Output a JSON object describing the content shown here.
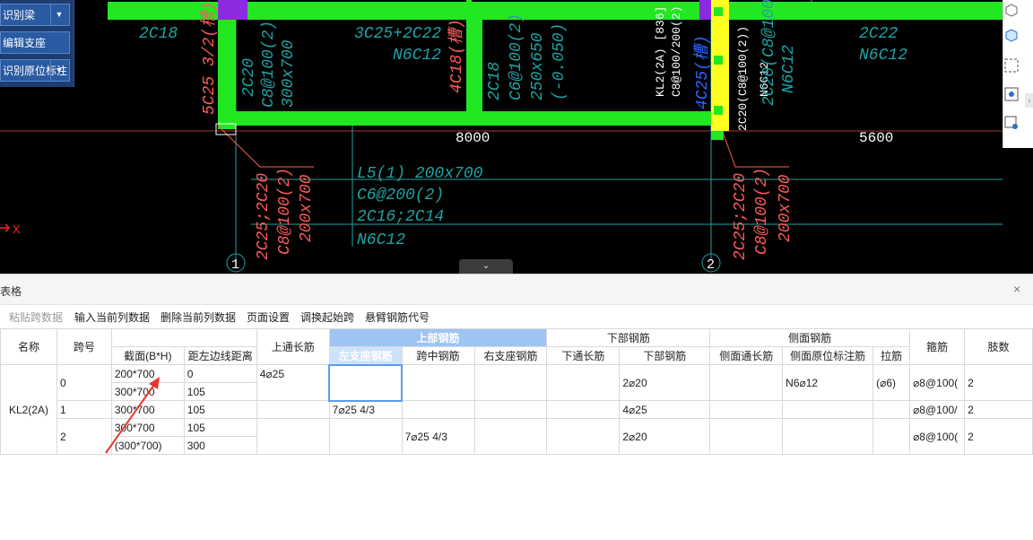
{
  "left_panel": {
    "items": [
      "识别梁",
      "编辑支座",
      "识别原位标注"
    ]
  },
  "cad": {
    "colors": {
      "beam": "#22e822",
      "cyan": "#1fa3a3",
      "red": "#ff5a5a",
      "white": "#ffffff",
      "yellow": "#ffff22",
      "purple": "#8a2be2"
    },
    "labels": {
      "t1": "2C18",
      "t2": "3C25+2C22",
      "t3": "N6C12",
      "t4": "5C25 3/2(槽)",
      "t5": "2C20",
      "t6": "C8@100(2)",
      "t7": "300x700",
      "t8": "4C18(槽)",
      "t9": "2C18",
      "t10": "C6@100(2)",
      "t11": "250x650",
      "t12": "(-0.050)",
      "t13": "KL2(2A) [836] 300x",
      "t14": "C8@100/200(2)",
      "t15": "4C25(槽)",
      "t16": "2C20(C8@100(2))",
      "t17": "N6C12",
      "t18": "2C22",
      "t19": "N6C12",
      "t20": "2C20(C8@100(2)",
      "t21": "N6C12",
      "dim1": "8000",
      "dim2": "5600",
      "l5a": "L5(1) 200x700",
      "l5b": "C6@200(2)",
      "l5c": "2C16;2C14",
      "l5d": "N6C12",
      "col1a": "2C25;2C20",
      "col1b": "C8@100(2)",
      "col1c": "200x700",
      "col2a": "2C25;2C20",
      "col2b": "C8@100(2)",
      "col2c": "200x700",
      "axis1": "1",
      "axis2": "2",
      "axis_x": "X"
    }
  },
  "panel": {
    "title": "表格",
    "close": "×",
    "toolbar": [
      "粘贴跨数据",
      "输入当前列数据",
      "删除当前列数据",
      "页面设置",
      "调换起始跨",
      "悬臂钢筋代号"
    ]
  },
  "table": {
    "headers": {
      "name": "名称",
      "span": "跨号",
      "section": "截面(B*H)",
      "dist": "距左边线距离",
      "top_through": "上通长筋",
      "top_group": "上部钢筋",
      "left_support": "左支座钢筋",
      "mid_span": "跨中钢筋",
      "right_support": "右支座钢筋",
      "bottom_group": "下部钢筋",
      "bottom_through": "下通长筋",
      "bottom_bar": "下部钢筋",
      "side_group": "侧面钢筋",
      "side_through": "侧面通长筋",
      "side_local": "侧面原位标注筋",
      "tie": "拉筋",
      "stirrup": "箍筋",
      "legs": "肢数"
    },
    "name": "KL2(2A)",
    "rows": [
      {
        "span": "0",
        "section_a": "200*700",
        "dist_a": "0",
        "section_b": "300*700",
        "dist_b": "105",
        "top_through": "4⌀25",
        "left_support": "",
        "mid_span": "",
        "right_support": "",
        "bottom_through": "",
        "bottom_bar": "2⌀20",
        "side_through": "",
        "side_local": "N6⌀12",
        "tie": "(⌀6)",
        "stirrup": "⌀8@100(",
        "legs": "2"
      },
      {
        "span": "1",
        "section_a": "300*700",
        "dist_a": "105",
        "top_through": "",
        "left_support": "7⌀25 4/3",
        "mid_span": "",
        "right_support": "",
        "bottom_through": "",
        "bottom_bar": "4⌀25",
        "side_through": "",
        "side_local": "",
        "tie": "",
        "stirrup": "⌀8@100/",
        "legs": "2"
      },
      {
        "span": "2",
        "section_a": "300*700",
        "dist_a": "105",
        "section_b": "(300*700)",
        "dist_b": "300",
        "top_through": "",
        "left_support": "",
        "mid_span": "7⌀25 4/3",
        "right_support": "",
        "bottom_through": "",
        "bottom_bar": "2⌀20",
        "side_through": "",
        "side_local": "",
        "tie": "",
        "stirrup": "⌀8@100(",
        "legs": "2"
      }
    ]
  }
}
